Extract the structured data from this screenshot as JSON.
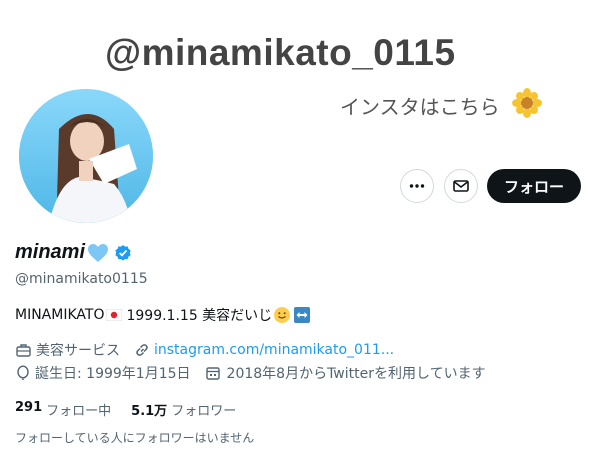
{
  "banner": {
    "handle_text": "@minamikato_0115",
    "sub_text": "インスタはこちら",
    "flower_icon": "sunflower-icon"
  },
  "actions": {
    "more_icon": "more-icon",
    "mail_icon": "mail-icon",
    "follow_label": "フォロー"
  },
  "profile": {
    "name": "minami",
    "name_emoji": "blue-heart-icon",
    "verified_icon": "verified-badge-icon",
    "handle": "@minamikato0115",
    "bio": {
      "name": "MINAMIKATO",
      "flag_icon": "japan-flag-icon",
      "text": "1999.1.15 美容だいじ",
      "emoji": "slightly-smiling-face-icon",
      "emoji2": "left-right-arrow-icon"
    },
    "category": "美容サービス",
    "link": "instagram.com/minamikato_011...",
    "birthday": "誕生日: 1999年1月15日",
    "joined": "2018年8月からTwitterを利用しています"
  },
  "stats": {
    "following_count": "291",
    "following_label": "フォロー中",
    "followers_count": "5.1万",
    "followers_label": "フォロワー"
  },
  "mutual_text": "フォローしている人にフォロワーはいません",
  "colors": {
    "accent": "#1d9bf0",
    "text": "#0f1419",
    "muted": "#536471",
    "follow_bg": "#0f1419"
  }
}
